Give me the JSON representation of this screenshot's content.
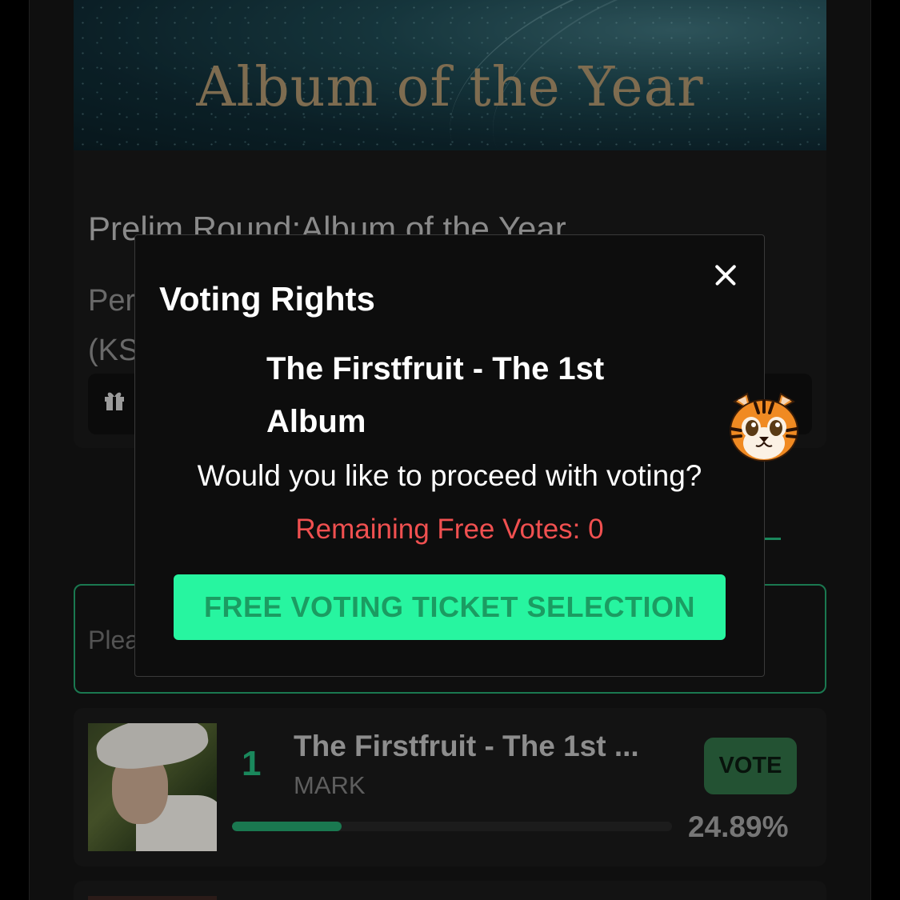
{
  "banner": {
    "title": "Album of the Year"
  },
  "info": {
    "prelim_title": "Prelim Round:Album of the Year",
    "period_line1": "Per",
    "period_line2": "(KS"
  },
  "search": {
    "placeholder": "Plea"
  },
  "nominee": {
    "rank": "1",
    "title": "The Firstfruit - The 1st ...",
    "artist": "MARK",
    "vote_label": "VOTE",
    "percent_text": "24.89%",
    "progress": 0.2489
  },
  "modal": {
    "title": "Voting Rights",
    "album_line1": "The Firstfruit - The 1st",
    "album_line2": "Album",
    "question": "Would you like to proceed with voting?",
    "remaining": "Remaining Free Votes: 0",
    "button_label": "FREE VOTING TICKET SELECTION"
  },
  "icons": {
    "close": "close-icon",
    "gift": "gift-icon",
    "mascot": "tiger-icon"
  },
  "colors": {
    "accent": "#27f5a0",
    "accent_dark": "#23b67b",
    "warning": "#f05050",
    "vote_button": "#2f6e45"
  }
}
